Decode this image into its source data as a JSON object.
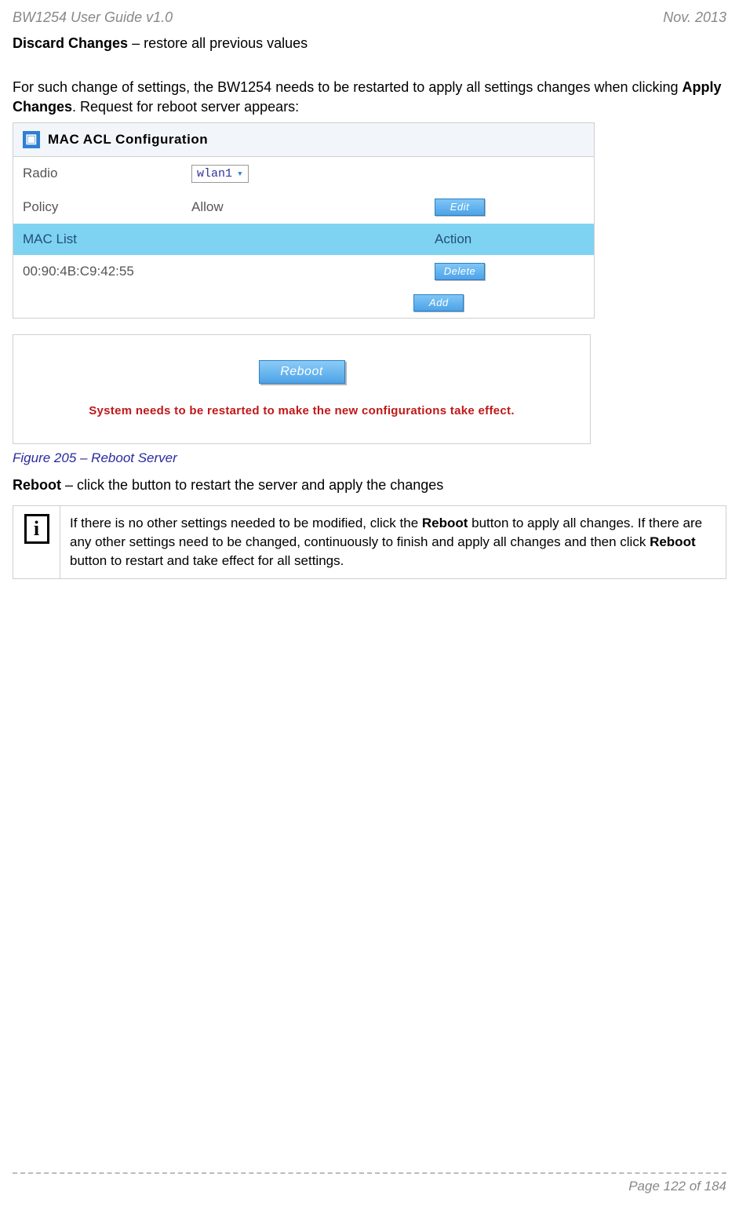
{
  "header": {
    "left": "BW1254 User Guide v1.0",
    "right": "Nov.  2013"
  },
  "para": {
    "discard_label": "Discard Changes",
    "discard_rest": " – restore all previous values",
    "change1a": "For such change of settings, the BW1254 needs to be restarted to apply all settings changes when clicking ",
    "change1b": "Apply Changes",
    "change1c": ". Request for reboot server appears:"
  },
  "macacl": {
    "title": "MAC ACL Configuration",
    "radio_label": "Radio",
    "radio_value": "wlan1",
    "policy_label": "Policy",
    "policy_value": "Allow",
    "edit_btn": "Edit",
    "hdr_maclist": "MAC List",
    "hdr_action": "Action",
    "mac_entry": "00:90:4B:C9:42:55",
    "delete_btn": "Delete",
    "add_btn": "Add"
  },
  "reboot": {
    "button": "Reboot",
    "message": "System needs to be restarted to make the new configurations take effect."
  },
  "figure_caption": "Figure 205 – Reboot Server",
  "reboot_desc": {
    "label": "Reboot",
    "rest": " – click the button to restart the server and apply the changes"
  },
  "infobox": {
    "t1": "If there is no other settings needed to be modified, click the ",
    "b1": "Reboot",
    "t2": " button to apply all changes. If there are any other settings need to be changed, continuously to finish and apply all changes and then click ",
    "b2": "Reboot",
    "t3": " button to restart and take effect  for all settings."
  },
  "footer": "Page 122 of 184"
}
